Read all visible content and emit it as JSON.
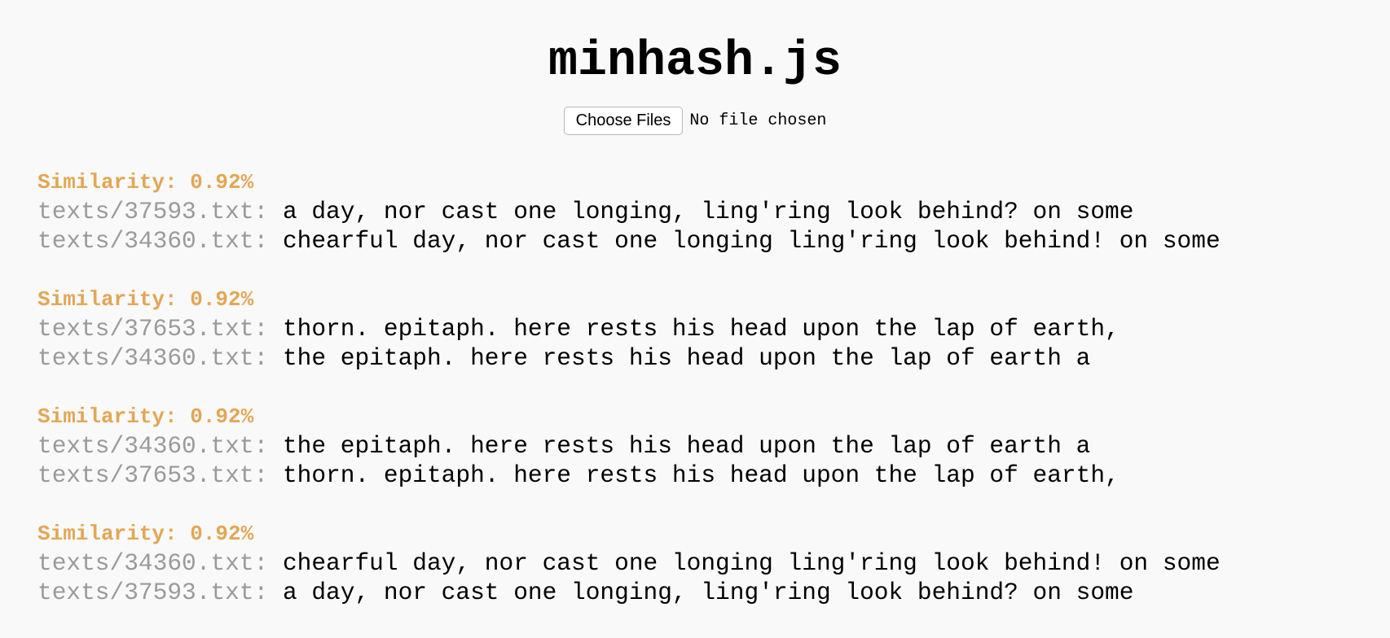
{
  "page": {
    "title": "minhash.js"
  },
  "file_picker": {
    "button_label": "Choose Files",
    "status": "No file chosen"
  },
  "results": [
    {
      "similarity": "Similarity: 0.92%",
      "lines": [
        {
          "file": "texts/37593.txt:",
          "text": "a day, nor cast one longing, ling'ring look behind? on some"
        },
        {
          "file": "texts/34360.txt:",
          "text": "chearful day, nor cast one longing ling'ring look behind! on some"
        }
      ]
    },
    {
      "similarity": "Similarity: 0.92%",
      "lines": [
        {
          "file": "texts/37653.txt:",
          "text": "thorn. epitaph. here rests his head upon the lap of earth,"
        },
        {
          "file": "texts/34360.txt:",
          "text": "the epitaph. here rests his head upon the lap of earth a"
        }
      ]
    },
    {
      "similarity": "Similarity: 0.92%",
      "lines": [
        {
          "file": "texts/34360.txt:",
          "text": "the epitaph. here rests his head upon the lap of earth a"
        },
        {
          "file": "texts/37653.txt:",
          "text": "thorn. epitaph. here rests his head upon the lap of earth,"
        }
      ]
    },
    {
      "similarity": "Similarity: 0.92%",
      "lines": [
        {
          "file": "texts/34360.txt:",
          "text": "chearful day, nor cast one longing ling'ring look behind! on some"
        },
        {
          "file": "texts/37593.txt:",
          "text": "a day, nor cast one longing, ling'ring look behind? on some"
        }
      ]
    }
  ]
}
